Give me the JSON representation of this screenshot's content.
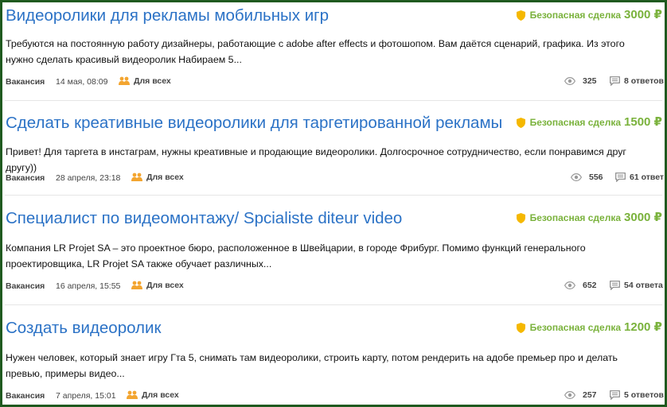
{
  "listings": [
    {
      "title": "Видеоролики для рекламы мобильных игр",
      "safe_deal": "Безопасная сделка",
      "price": "3000 ₽",
      "description": "Требуются на постоянную работу дизайнеры, работающие с adobe after effects и фотошопом. Вам даётся сценарий, графика. Из этого нужно сделать красивый видеоролик Набираем 5...",
      "type": "Вакансия",
      "date": "14 мая, 08:09",
      "audience": "Для всех",
      "views": "325",
      "answers": "8 ответов"
    },
    {
      "title": "Сделать креативные видеоролики для таргетированной рекламы",
      "safe_deal": "Безопасная сделка",
      "price": "1500 ₽",
      "description": "Привет! Для таргета в инстаграм, нужны креативные и продающие видеоролики. Долгосрочное сотрудничество, если понравимся друг другу))",
      "type": "Вакансия",
      "date": "28 апреля, 23:18",
      "audience": "Для всех",
      "views": "556",
      "answers": "61 ответ"
    },
    {
      "title": "Специалист по видеомонтажу/ Spcialiste diteur video",
      "safe_deal": "Безопасная сделка",
      "price": "3000 ₽",
      "description": "Компания LR Projet SA – это проектное бюро, расположенное в Швейцарии, в городе Фрибург. Помимо функций генерального проектировщика, LR Projet SA также обучает различных...",
      "type": "Вакансия",
      "date": "16 апреля, 15:55",
      "audience": "Для всех",
      "views": "652",
      "answers": "54 ответа"
    },
    {
      "title": "Создать видеоролик",
      "safe_deal": "Безопасная сделка",
      "price": "1200 ₽",
      "description": "Нужен человек, который знает игру Гта 5, снимать там видеоролики, строить карту, потом рендерить на адобе премьер про и делать превью, примеры видео...",
      "type": "Вакансия",
      "date": "7 апреля, 15:01",
      "audience": "Для всех",
      "views": "257",
      "answers": "5 ответов"
    }
  ],
  "colors": {
    "title": "#2b72c6",
    "price": "#7ab23c",
    "shield": "#f5b800",
    "audience_icon": "#f3a530",
    "frame": "#1f5a1f"
  },
  "icons": {
    "safe_deal": "shield-icon",
    "audience": "users-icon",
    "views": "eye-icon",
    "answers": "comment-icon"
  }
}
